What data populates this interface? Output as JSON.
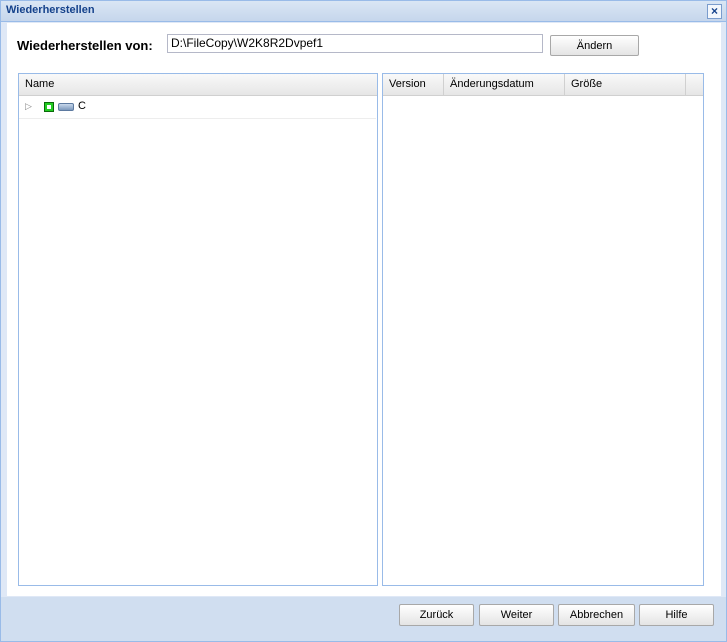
{
  "window": {
    "title": "Wiederherstellen"
  },
  "source": {
    "label": "Wiederherstellen von:",
    "path": "D:\\FileCopy\\W2K8R2Dvpef1",
    "change_button": "Ändern"
  },
  "tree": {
    "column_name": "Name",
    "items": [
      {
        "label": "C",
        "icon": "drive-icon",
        "checked": true
      }
    ]
  },
  "versions": {
    "columns": [
      "Version",
      "Änderungsdatum",
      "Größe"
    ]
  },
  "buttons": {
    "back": "Zurück",
    "next": "Weiter",
    "cancel": "Abbrechen",
    "help": "Hilfe"
  },
  "colors": {
    "accent": "#15428b",
    "border": "#99bbe8",
    "footer": "#d0def0"
  }
}
